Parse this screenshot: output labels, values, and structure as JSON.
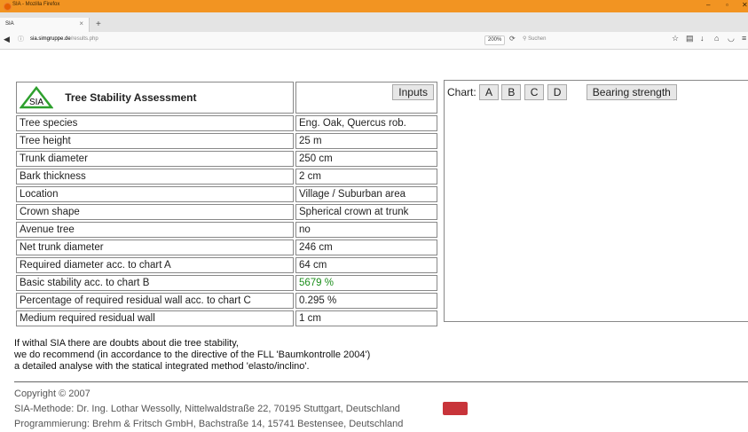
{
  "browser": {
    "window_title": "SIA - Mozilla Firefox",
    "tab_label": "SIA",
    "url_domain": "sia.simgruppe.de",
    "url_path": "/results.php",
    "zoom": "200%",
    "search_placeholder": "Suchen"
  },
  "header": {
    "logo_text": "SIA",
    "title": "Tree Stability Assessment",
    "inputs_button": "Inputs"
  },
  "chart_panel": {
    "label": "Chart:",
    "buttons": [
      "A",
      "B",
      "C",
      "D"
    ],
    "bearing_button": "Bearing strength"
  },
  "rows": [
    {
      "label": "Tree species",
      "value": "Eng. Oak, Quercus rob."
    },
    {
      "label": "Tree height",
      "value": "25 m"
    },
    {
      "label": "Trunk diameter",
      "value": "250 cm"
    },
    {
      "label": "Bark thickness",
      "value": "2 cm"
    },
    {
      "label": "Location",
      "value": "Village / Suburban area"
    },
    {
      "label": "Crown shape",
      "value": "Spherical crown at trunk"
    },
    {
      "label": "Avenue tree",
      "value": "no"
    },
    {
      "label": "Net trunk diameter",
      "value": "246 cm"
    },
    {
      "label": "Required diameter acc. to chart A",
      "value": "64 cm"
    },
    {
      "label": "Basic stability acc. to chart B",
      "value": "5679 %"
    },
    {
      "label": "Percentage of required residual wall acc. to chart C",
      "value": "0.295 %"
    },
    {
      "label": "Medium required residual wall",
      "value": "1 cm"
    }
  ],
  "colors": {
    "highlight": "#1c8e1c",
    "titlebar": "#f29422"
  },
  "notice": [
    "If withal SIA there are doubts about die tree stability,",
    "we do recommend (in accordance to the directive of the FLL 'Baumkontrolle 2004')",
    "a detailed analyse with the statical integrated method 'elasto/inclino'."
  ],
  "footer": [
    "Copyright © 2007",
    "SIA-Methode: Dr. Ing. Lothar Wessolly, Nittelwaldstraße 22, 70195 Stuttgart, Deutschland",
    "Programmierung: Brehm & Fritsch GmbH, Bachstraße 14, 15741 Bestensee, Deutschland"
  ]
}
